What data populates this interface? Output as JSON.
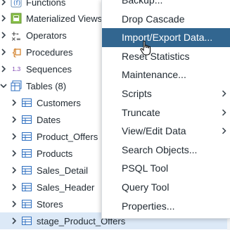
{
  "tree": {
    "items": [
      {
        "label": "Functions",
        "icon": "functions-icon",
        "expander": "chevron-right"
      },
      {
        "label": "Materialized Views",
        "icon": "materialized-view-icon",
        "expander": "chevron-right"
      },
      {
        "label": "Operators",
        "icon": "operators-icon",
        "expander": "chevron-right"
      },
      {
        "label": "Procedures",
        "icon": "procedures-icon",
        "expander": "chevron-right"
      },
      {
        "label": "Sequences",
        "icon": "sequences-icon",
        "icon_text": "1..3",
        "expander": "chevron-right"
      },
      {
        "label": "Tables (8)",
        "icon": "tables-icon",
        "expander": "chevron-down"
      },
      {
        "label": "Customers",
        "icon": "table-icon",
        "expander": "chevron-right"
      },
      {
        "label": "Dates",
        "icon": "table-icon",
        "expander": "chevron-right"
      },
      {
        "label": "Product_Offers",
        "icon": "table-icon",
        "expander": "chevron-right"
      },
      {
        "label": "Products",
        "icon": "table-icon",
        "expander": "chevron-right"
      },
      {
        "label": "Sales_Detail",
        "icon": "table-icon",
        "expander": "chevron-right"
      },
      {
        "label": "Sales_Header",
        "icon": "table-icon",
        "expander": "chevron-right"
      },
      {
        "label": "Stores",
        "icon": "table-icon",
        "expander": "chevron-right"
      },
      {
        "label": "stage_Product_Offers",
        "icon": "table-icon",
        "expander": "chevron-right",
        "selected": true
      }
    ]
  },
  "context_menu": {
    "items": [
      {
        "label": "Backup...",
        "submenu": false
      },
      {
        "label": "Drop Cascade",
        "submenu": false
      },
      {
        "label": "Import/Export Data...",
        "submenu": false,
        "highlighted": true
      },
      {
        "label": "Reset Statistics",
        "submenu": false
      },
      {
        "label": "Maintenance...",
        "submenu": false
      },
      {
        "label": "Scripts",
        "submenu": true
      },
      {
        "label": "Truncate",
        "submenu": true
      },
      {
        "label": "View/Edit Data",
        "submenu": true
      },
      {
        "label": "Search Objects...",
        "submenu": false
      },
      {
        "label": "PSQL Tool",
        "submenu": false
      },
      {
        "label": "Query Tool",
        "submenu": false
      },
      {
        "label": "Properties...",
        "submenu": false
      }
    ]
  },
  "colors": {
    "menu_highlight": "#326690",
    "selected_row": "#dce9f7",
    "table_icon": "#2e6fc0",
    "procedures_icon": "#d07a1e",
    "sequences_icon": "#7a3fb0"
  }
}
